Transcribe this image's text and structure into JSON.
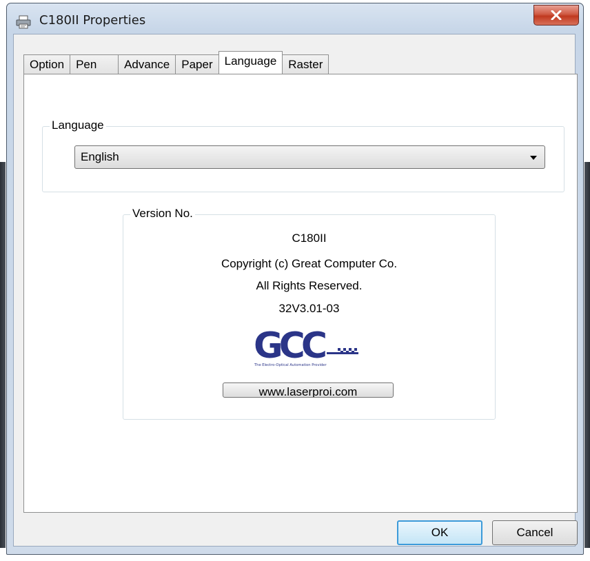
{
  "window": {
    "title": "C180II Properties"
  },
  "tabs": [
    {
      "label": "Option"
    },
    {
      "label": "Pen"
    },
    {
      "label": "Advance"
    },
    {
      "label": "Paper"
    },
    {
      "label": "Language",
      "active": true
    },
    {
      "label": "Raster"
    }
  ],
  "language_group": {
    "label": "Language",
    "selected": "English"
  },
  "version_group": {
    "label": "Version No.",
    "model": "C180II",
    "copyright": "Copyright (c) Great Computer Co.",
    "rights": "All Rights Reserved.",
    "version": "32V3.01-03",
    "logo_text": "GCC",
    "logo_tagline": "The Electro-Optical Automation Provider",
    "url": "www.laserproi.com"
  },
  "footer": {
    "ok_label": "OK",
    "cancel_label": "Cancel"
  },
  "colors": {
    "gcc_blue": "#2b3588",
    "close_red": "#c8462e",
    "ok_border": "#3c9ad9"
  },
  "icons": [
    "printer-icon",
    "close-icon",
    "dropdown-arrow-icon",
    "gcc-logo"
  ]
}
